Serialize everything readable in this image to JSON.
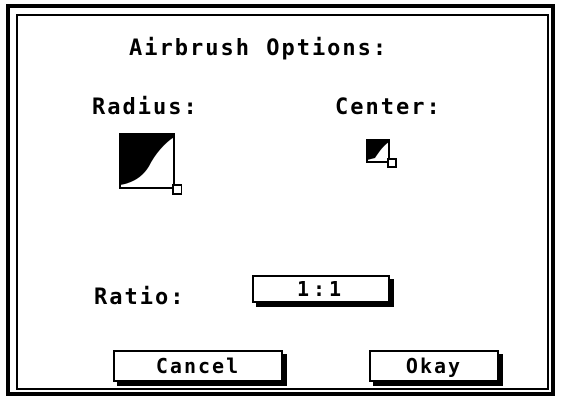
{
  "dialog": {
    "title": "Airbrush Options:",
    "radius_label": "Radius:",
    "center_label": "Center:",
    "ratio_label": "Ratio:",
    "ratio_value": "1:1",
    "cancel_label": "Cancel",
    "okay_label": "Okay"
  },
  "icons": {
    "radius_control": "radius-ramp-icon",
    "center_control": "center-ramp-icon"
  },
  "colors": {
    "foreground": "#000000",
    "background": "#ffffff"
  }
}
